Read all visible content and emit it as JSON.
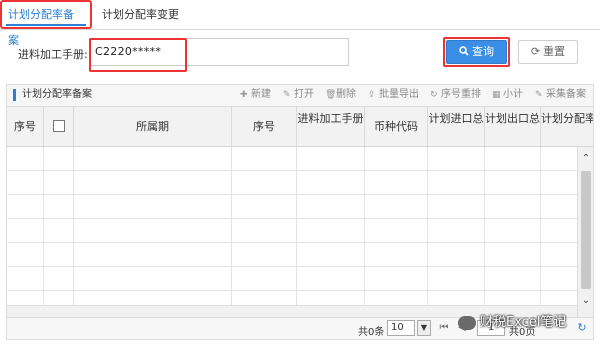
{
  "tabs": [
    {
      "label": "计划分配率备案"
    },
    {
      "label": "计划分配率变更"
    }
  ],
  "filter": {
    "label": "进料加工手册:",
    "value": "C2220*****",
    "query_label": "查询",
    "reset_label": "重置"
  },
  "toolbar": {
    "title": "计划分配率备案",
    "actions": [
      {
        "label": "新建",
        "icon": "plus-icon"
      },
      {
        "label": "打开",
        "icon": "edit-icon"
      },
      {
        "label": "删除",
        "icon": "trash-icon"
      },
      {
        "label": "批量导出",
        "icon": "export-icon"
      },
      {
        "label": "序号重排",
        "icon": "refresh-icon"
      },
      {
        "label": "小计",
        "icon": "calculator-icon"
      },
      {
        "label": "采集备案",
        "icon": "edit-icon"
      }
    ]
  },
  "table": {
    "columns": [
      "序号",
      "",
      "所属期",
      "序号",
      "进料加工手册",
      "币种代码",
      "计划进口总",
      "计划出口总",
      "计划分配率"
    ],
    "rows": []
  },
  "pagination": {
    "total_text": "共0条",
    "page_size": "10",
    "page": "1",
    "pages_text": "共0页"
  },
  "watermark": {
    "text": "财税Excel笔记"
  },
  "colors": {
    "accent": "#3a8ee6",
    "highlight": "#e33333",
    "tab_active": "#2b7fd4"
  }
}
